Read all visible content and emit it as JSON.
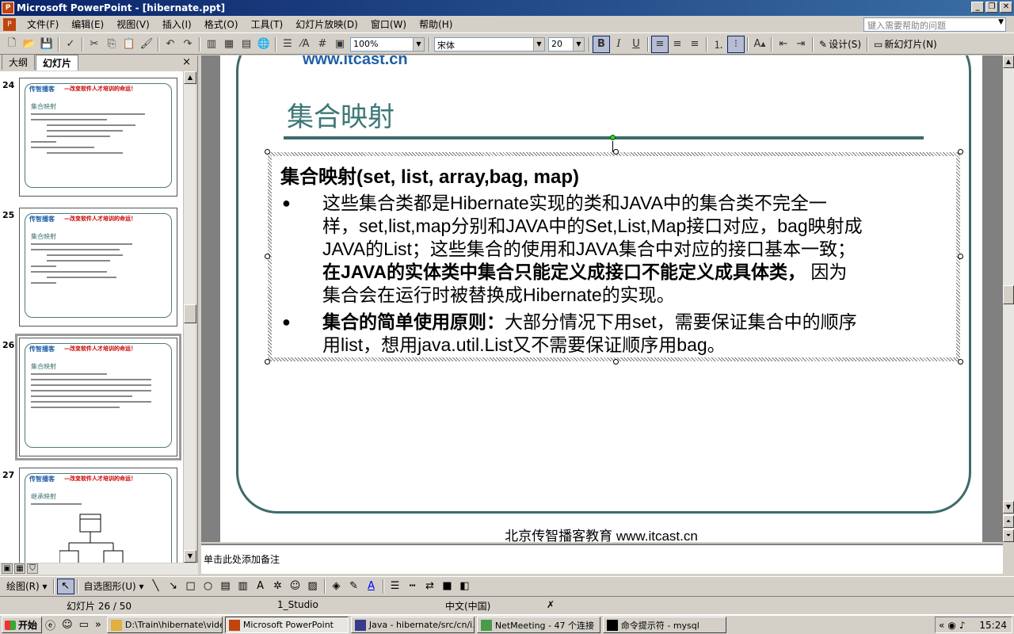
{
  "window": {
    "title": "Microsoft PowerPoint - [hibernate.ppt]",
    "min": "_",
    "restore": "❐",
    "close": "✕"
  },
  "menu": {
    "items": [
      "文件(F)",
      "编辑(E)",
      "视图(V)",
      "插入(I)",
      "格式(O)",
      "工具(T)",
      "幻灯片放映(D)",
      "窗口(W)",
      "帮助(H)"
    ],
    "help_placeholder": "键入需要帮助的问题"
  },
  "toolbar": {
    "zoom": "100%",
    "font": "宋体",
    "font_size": "20",
    "bold": "B",
    "italic": "I",
    "underline": "U",
    "design_label": "设计(S)",
    "new_slide_label": "新幻灯片(N)"
  },
  "left_pane": {
    "tabs": [
      "大纲",
      "幻灯片"
    ],
    "close": "×",
    "thumbnails": [
      {
        "num": "24",
        "logo": "传智播客",
        "slogan": "—改变软件人才培训的命运！",
        "title": "集合映射"
      },
      {
        "num": "25",
        "logo": "传智播客",
        "slogan": "—改变软件人才培训的命运！",
        "title": "集合映射"
      },
      {
        "num": "26",
        "logo": "传智播客",
        "slogan": "—改变软件人才培训的命运！",
        "title": "集合映射"
      },
      {
        "num": "27",
        "logo": "传智播客",
        "slogan": "—改变软件人才培训的命运！",
        "title": "继承映射"
      }
    ]
  },
  "slide": {
    "top_url": "www.itcast.cn",
    "title": "集合映射",
    "heading": "集合映射(set, list, array,bag, map)",
    "bullet1_lines": [
      "这些集合类都是Hibernate实现的类和JAVA中的集合类不完全一",
      "样，set,list,map分别和JAVA中的Set,List,Map接口对应，bag映射成",
      "JAVA的List；这些集合的使用和JAVA集合中对应的接口基本一致；"
    ],
    "bullet1_bold": "在JAVA的实体类中集合只能定义成接口不能定义成具体类，",
    "bullet1_tail": " 因为",
    "bullet1_last": "集合会在运行时被替换成Hibernate的实现。",
    "bullet2_bold": "集合的简单使用原则：",
    "bullet2_line1": "大部分情况下用set，需要保证集合中的顺序",
    "bullet2_line2": "用list，想用java.util.List又不需要保证顺序用bag。",
    "footer": "北京传智播客教育 www.itcast.cn"
  },
  "notes": {
    "placeholder": "单击此处添加备注"
  },
  "drawing_toolbar": {
    "draw_label": "绘图(R)",
    "autoshapes_label": "自选图形(U)"
  },
  "status": {
    "slide_position": "幻灯片 26 / 50",
    "design": "1_Studio",
    "language": "中文(中国)"
  },
  "taskbar": {
    "start": "开始",
    "tasks": [
      "D:\\Train\\hibernate\\video",
      "Microsoft PowerPoint",
      "Java - hibernate/src/cn/i...",
      "NetMeeting - 47 个连接",
      "命令提示符 - mysql"
    ],
    "clock": "15:24"
  }
}
